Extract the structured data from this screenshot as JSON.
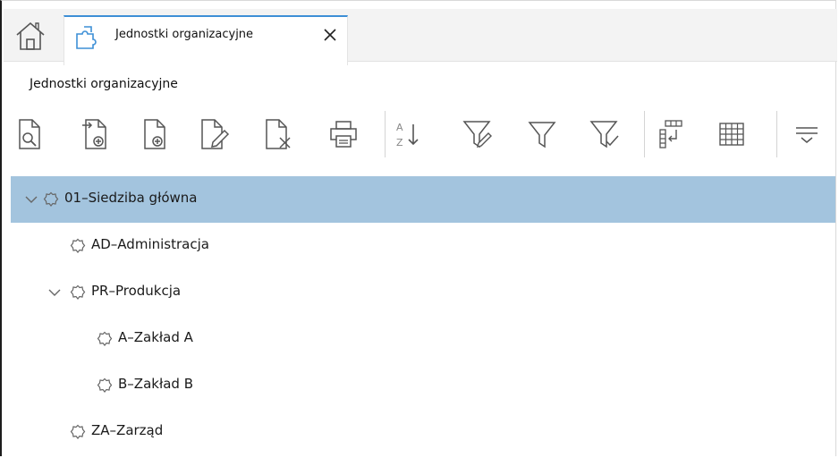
{
  "tabs": {
    "home_icon": "home-icon",
    "active": {
      "label": "Jednostki organizacyjne",
      "icon": "puzzle-icon",
      "close_icon": "close-icon"
    }
  },
  "section": {
    "title": "Jednostki organizacyjne"
  },
  "toolbar": {
    "buttons": [
      {
        "icon": "document-search-icon"
      },
      {
        "icon": "document-add-from-icon"
      },
      {
        "icon": "document-add-icon"
      },
      {
        "icon": "document-edit-icon"
      },
      {
        "icon": "document-delete-icon"
      },
      {
        "icon": "printer-icon"
      },
      {
        "icon": "sort-az-icon"
      },
      {
        "icon": "filter-edit-icon"
      },
      {
        "icon": "filter-icon"
      },
      {
        "icon": "filter-apply-icon"
      },
      {
        "icon": "columns-move-icon"
      },
      {
        "icon": "grid-icon"
      },
      {
        "icon": "menu-more-icon"
      }
    ]
  },
  "tree": {
    "items": [
      {
        "label": "01–Siedziba główna",
        "level": 0,
        "expanded": true,
        "selected": true
      },
      {
        "label": "AD–Administracja",
        "level": 1,
        "expanded": false,
        "selected": false
      },
      {
        "label": "PR–Produkcja",
        "level": 1,
        "expanded": true,
        "selected": false
      },
      {
        "label": "A–Zakład A",
        "level": 2,
        "expanded": false,
        "selected": false
      },
      {
        "label": "B–Zakład B",
        "level": 2,
        "expanded": false,
        "selected": false
      },
      {
        "label": "ZA–Zarząd",
        "level": 1,
        "expanded": false,
        "selected": false
      }
    ]
  },
  "colors": {
    "accent": "#3d8fd6",
    "selected_row": "#a3c4de",
    "icon": "#555555"
  }
}
